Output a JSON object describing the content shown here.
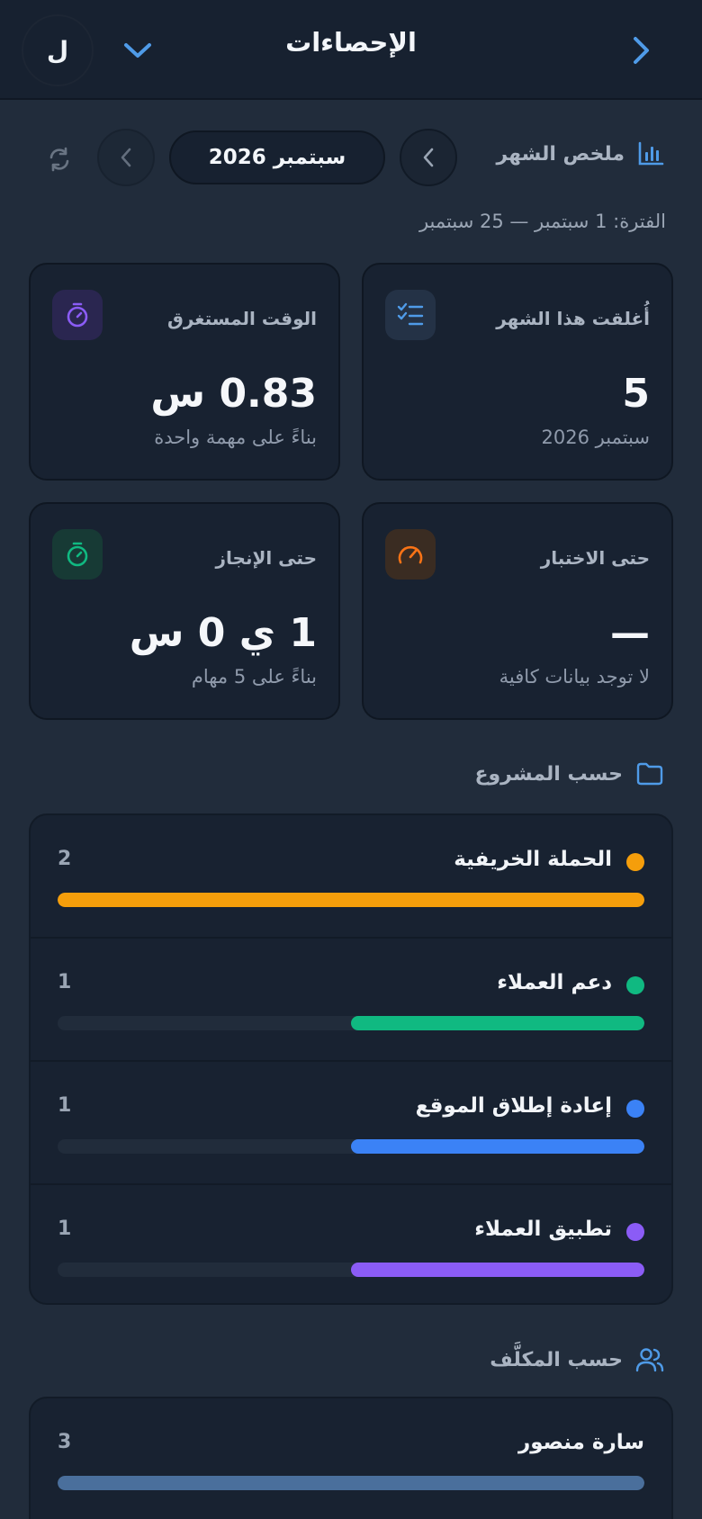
{
  "header": {
    "title": "الإحصاءات",
    "avatar_initial": "ل"
  },
  "summary": {
    "label": "ملخص الشهر",
    "month": "سبتمبر 2026",
    "period": "الفترة: 1 سبتمبر — 25 سبتمبر"
  },
  "cards": [
    {
      "label": "أُغلقت هذا الشهر",
      "value": "5",
      "sub": "سبتمبر 2026",
      "icon": "checklist-icon",
      "accent": "#3b82f6"
    },
    {
      "label": "الوقت المستغرق",
      "value": "0.83 س",
      "sub": "بناءً على مهمة واحدة",
      "icon": "stopwatch-icon",
      "accent": "#8b5cf6"
    },
    {
      "label": "حتى الاختبار",
      "value": "—",
      "sub": "لا توجد بيانات كافية",
      "icon": "gauge-icon",
      "accent": "#f97316"
    },
    {
      "label": "حتى الإنجاز",
      "value": "1 ي 0 س",
      "sub": "بناءً على 5 مهام",
      "icon": "timer-icon",
      "accent": "#10b981"
    }
  ],
  "by_project": {
    "heading": "حسب المشروع",
    "items": [
      {
        "name": "الحملة الخريفية",
        "count": "2",
        "share": 1.0,
        "color": "#f59e0b"
      },
      {
        "name": "دعم العملاء",
        "count": "1",
        "share": 0.5,
        "color": "#10b981"
      },
      {
        "name": "إعادة إطلاق الموقع",
        "count": "1",
        "share": 0.5,
        "color": "#3b82f6"
      },
      {
        "name": "تطبيق العملاء",
        "count": "1",
        "share": 0.5,
        "color": "#8b5cf6"
      }
    ]
  },
  "by_assignee": {
    "heading": "حسب المكلَّف",
    "items": [
      {
        "name": "سارة منصور",
        "count": "3",
        "share": 1.0,
        "color": "#4a6f9c"
      }
    ]
  }
}
